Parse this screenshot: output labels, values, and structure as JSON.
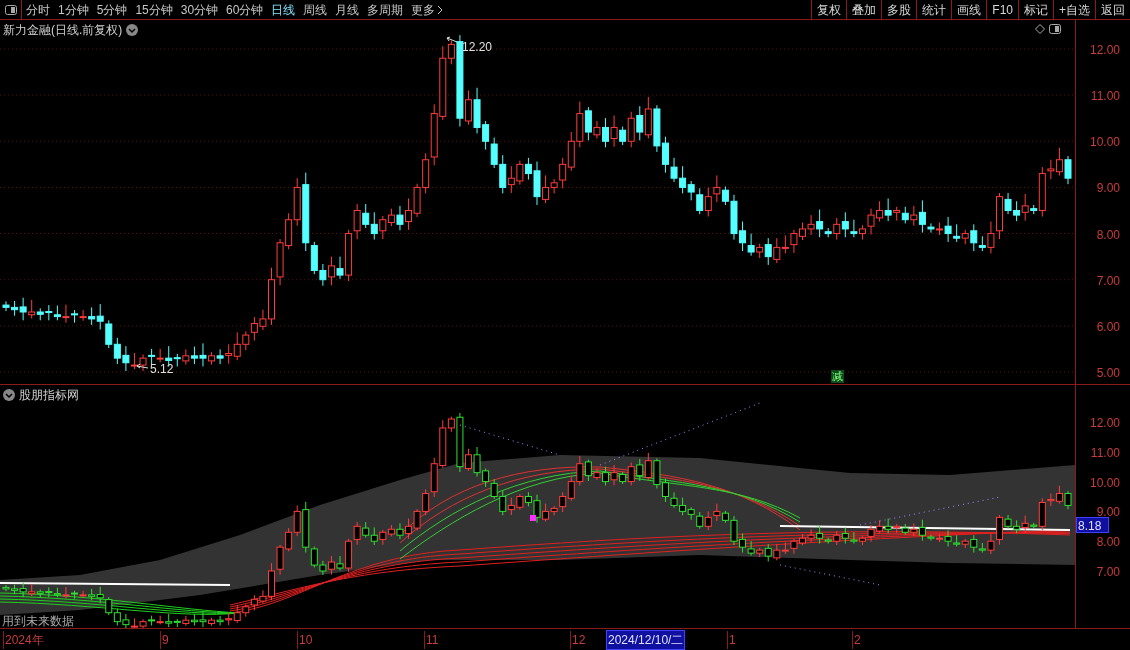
{
  "toolbar": {
    "periods": [
      {
        "label": "分时",
        "selected": false
      },
      {
        "label": "1分钟",
        "selected": false
      },
      {
        "label": "5分钟",
        "selected": false
      },
      {
        "label": "15分钟",
        "selected": false
      },
      {
        "label": "30分钟",
        "selected": false
      },
      {
        "label": "60分钟",
        "selected": false
      },
      {
        "label": "日线",
        "selected": true
      },
      {
        "label": "周线",
        "selected": false
      },
      {
        "label": "月线",
        "selected": false
      },
      {
        "label": "多周期",
        "selected": false
      },
      {
        "label": "更多",
        "selected": false
      }
    ],
    "actions": [
      "复权",
      "叠加",
      "多股",
      "统计",
      "画线",
      "F10",
      "标记",
      "+自选",
      "返回"
    ]
  },
  "main_chart": {
    "title": "新力金融(日线.前复权)",
    "y_labels": [
      "12.00",
      "11.00",
      "10.00",
      "9.00",
      "8.00",
      "7.00",
      "6.00",
      "5.00"
    ],
    "high_label": "12.20",
    "low_label": "5.12",
    "signal_badge": "减"
  },
  "indicator": {
    "title": "股朋指标网",
    "note": "用到未来数据",
    "y_labels": [
      "12.00",
      "11.00",
      "10.00",
      "9.00",
      "8.00",
      "7.00"
    ],
    "current_value": "8.18"
  },
  "date_axis": {
    "labels": [
      "2024年",
      "9",
      "10",
      "11",
      "12",
      "1",
      "2"
    ],
    "cursor_date": "2024/12/10/二"
  }
}
